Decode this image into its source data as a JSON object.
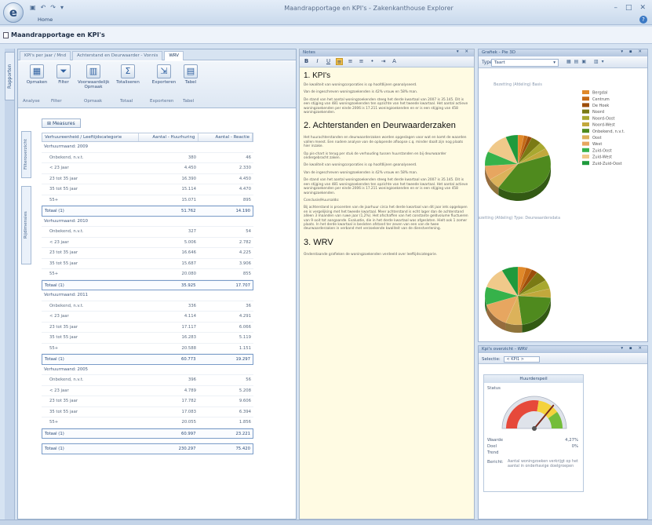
{
  "app": {
    "window_title": "Maandrapportage en KPI's - Zakenkanthouse Explorer",
    "ribbon_tab": "Home",
    "document_title": "Maandrapportage en KPI's",
    "left_strip_tab": "Rapporten"
  },
  "pivot": {
    "tabs": [
      "KPI's per jaar / Mnd",
      "Achterstand en Deurwaarder - Vonnis",
      "WRV"
    ],
    "active_tab": 2,
    "ribbon_buttons": [
      "Opmaken",
      "Filter",
      "Voorwaardelijk Opmaak",
      "Totaliseren",
      "Exporteren",
      "Tabel"
    ],
    "ribbon_groups": [
      "Analyse",
      "Filter",
      "Opmaak",
      "Totaal",
      "Exporteren",
      "Tabel"
    ],
    "measures_button": "Measures",
    "side_labels": [
      "Filteroverzicht",
      "Rijdimensies"
    ],
    "columns": [
      "Verhuureenheid / Leeftijdscategorie",
      "Aantal - Huurhuring",
      "Aantal - Reactie"
    ],
    "groups": [
      {
        "label": "Verhuurmaand: 2009",
        "rows": [
          {
            "label": "Onbekend, n.v.t.",
            "a": "380",
            "b": "46"
          },
          {
            "label": "< 23 jaar",
            "a": "4.450",
            "b": "2.330"
          },
          {
            "label": "23 tot 35 jaar",
            "a": "16.390",
            "b": "4.450"
          },
          {
            "label": "35 tot 55 jaar",
            "a": "15.114",
            "b": "4.470"
          },
          {
            "label": "55+",
            "a": "15.071",
            "b": "895"
          }
        ],
        "total": {
          "label": "Totaal (1)",
          "a": "51.762",
          "b": "14.190"
        }
      },
      {
        "label": "Verhuurmaand: 2010",
        "rows": [
          {
            "label": "Onbekend, n.v.t.",
            "a": "327",
            "b": "54"
          },
          {
            "label": "< 23 jaar",
            "a": "5.006",
            "b": "2.782"
          },
          {
            "label": "23 tot 35 jaar",
            "a": "16.646",
            "b": "4.225"
          },
          {
            "label": "35 tot 55 jaar",
            "a": "15.687",
            "b": "3.906"
          },
          {
            "label": "55+",
            "a": "20.080",
            "b": "855"
          }
        ],
        "total": {
          "label": "Totaal (1)",
          "a": "35.925",
          "b": "17.707"
        }
      },
      {
        "label": "Verhuurmaand: 2011",
        "rows": [
          {
            "label": "Onbekend, n.v.t.",
            "a": "336",
            "b": "36"
          },
          {
            "label": "< 23 jaar",
            "a": "4.114",
            "b": "4.291"
          },
          {
            "label": "23 tot 35 jaar",
            "a": "17.117",
            "b": "6.066"
          },
          {
            "label": "35 tot 55 jaar",
            "a": "16.283",
            "b": "5.119"
          },
          {
            "label": "55+",
            "a": "20.588",
            "b": "1.151"
          }
        ],
        "total": {
          "label": "Totaal (1)",
          "a": "60.773",
          "b": "19.297"
        }
      },
      {
        "label": "Verhuurmaand: 2005",
        "rows": [
          {
            "label": "Onbekend, n.v.t.",
            "a": "396",
            "b": "56"
          },
          {
            "label": "< 23 jaar",
            "a": "4.789",
            "b": "5.208"
          },
          {
            "label": "23 tot 35 jaar",
            "a": "17.782",
            "b": "9.606"
          },
          {
            "label": "35 tot 55 jaar",
            "a": "17.083",
            "b": "6.394"
          },
          {
            "label": "55+",
            "a": "20.055",
            "b": "1.856"
          }
        ],
        "total": {
          "label": "Totaal (1)",
          "a": "60.997",
          "b": "23.221"
        }
      }
    ],
    "grand_total": {
      "label": "Totaal (1)",
      "a": "230.297",
      "b": "75.420"
    }
  },
  "notes": {
    "title": "Notes",
    "sections": [
      {
        "heading": "1. KPI's",
        "paragraphs": [
          "De kwaliteit van woningcorporaties is op hoofdlijnen geanalyseerd.",
          "Van de ingeschreven woningzoekenden is 42% vrouw en 58% man.",
          "De stand van het aantal woningzoekenden steeg het derde kwartaal van 2007 is 35.145. Dit is een stijging van 481 woningzoekenden ten opzichte van het tweede kwartaal. Het aantal actieve woningzoekenden per einde 2006 is 17.211 woningzoekenden en er is een stijging van 458 woningzoekenden."
        ]
      },
      {
        "heading": "2. Achterstanden en Deurwaarderzaken",
        "paragraphs": [
          "Het huurachterstanden en deurwaarderzaken worden opgeslagen voor wat en komt de waarden vallen meest. Een nadere analyse van de oplopende afloopse c.q. minder daalt zijn nog plaats hier inzake.",
          "Op pis-chart is terug per stuk de verhouding tussen huurstanden en bij deurwaarder ondergebracht zaken.",
          "De kwaliteit van woningcorporaties is op hoofdlijnen geanalyseerd.",
          "Van de ingeschreven woningzoekenden is 42% vrouw en 58% man.",
          "De stand van het aantal woningzoekenden steeg het derde kwartaal van 2007 is 35.145. Dit is een stijging van 481 woningzoekenden ten opzichte van het tweede kwartaal. Het aantal actieve woningzoekenden per einde 2006 is 17.211 woningzoekenden en er is een stijging van 458 woningzoekenden.",
          "Conclusie/Huursaldo:",
          "Bij achterstand is procenten van de jaarhuur circa het derde kwartaal van dit jaar iets opgelopen en is vergelijking met het tweede kwartaal. Meer achterstand is echt lager dan de achterstand alleen 3 maanden van ruwe jaar (1,2%). Het afschaffen van het constante geldvolume fluctueren van 9 ooit tot aangaande. Evaluatie, die in het derde kwartaal was afgesloten. Hielt ook 1 zomer plaats. In het derde kwartaal is besloten afstand ter zeven van een van de twee deurwaarderzaken in verband met verzoekende kwaliteit van de dienstverlening."
        ]
      },
      {
        "heading": "3. WRV",
        "paragraphs": [
          "Onderstaande grafieken de woningzoekenden verdeeld over leeftijdscategorie."
        ]
      }
    ]
  },
  "chart_pane": {
    "title": "Grafiek - Pie 3D",
    "type_label": "Taart",
    "chart_prefix": "Type:"
  },
  "chart_data": [
    {
      "type": "pie",
      "title": "Bezetting (Afdeling) Basis",
      "categories": [
        "Bergdal",
        "Centrum",
        "De Hoek",
        "Noord",
        "Noord-Oost",
        "Noord-West",
        "Onbekend, n.v.t.",
        "Oost",
        "West",
        "Zuid-Oost",
        "Zuid-West",
        "Zuid-Zuid-Oost"
      ],
      "values": [
        3,
        2,
        2,
        5,
        4,
        4,
        40,
        6,
        8,
        8,
        12,
        6
      ]
    },
    {
      "type": "pie",
      "title": "Bezetting (Afdeling) Type: Deurwaardersdata",
      "categories": [
        "Bergdal",
        "Centrum",
        "De Hoek",
        "Noord",
        "Noord-Oost",
        "Noord-West",
        "Onbekend, n.v.t.",
        "Oost",
        "West",
        "Zuid-Oost",
        "Zuid-West",
        "Zuid-Zuid-Oost"
      ],
      "values": [
        4,
        3,
        3,
        6,
        5,
        5,
        22,
        8,
        14,
        10,
        12,
        8
      ]
    }
  ],
  "legend_colors": [
    "#e0892a",
    "#c56a16",
    "#9c4d0a",
    "#7a7a14",
    "#a8a830",
    "#c2a83c",
    "#4f8a1e",
    "#dcb25a",
    "#e7a660",
    "#36b24a",
    "#f0c98a",
    "#1f9a3c"
  ],
  "kpi_pane": {
    "title": "Kpi's overzicht - WRV",
    "toolbar_label": "Selectie:",
    "toolbar_value": "< KPI1 >",
    "card_title": "Huurderspeil",
    "status_label": "Status",
    "gauge_value": 0.72,
    "rows": [
      {
        "label": "Waarde",
        "value": "4,27%"
      },
      {
        "label": "Doel",
        "value": "0%"
      },
      {
        "label": "Trend",
        "value": ""
      }
    ],
    "note_label": "Bericht:",
    "note_text": "Aantal woningzoeken verkrijgt op het aantal in onderhavige doelgroepen"
  }
}
